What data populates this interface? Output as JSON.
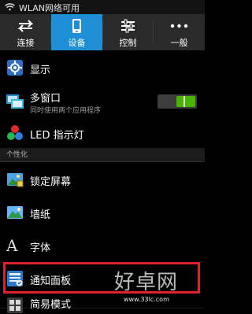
{
  "status_bar": {
    "wifi_icon": "wifi-icon",
    "text": "WLAN网络可用"
  },
  "tabs": [
    {
      "label": "连接",
      "icon": "swap-arrows-icon",
      "active": false
    },
    {
      "label": "设备",
      "icon": "phone-icon",
      "active": true
    },
    {
      "label": "控制",
      "icon": "sliders-icon",
      "active": false
    },
    {
      "label": "一般",
      "icon": "more-dots-icon",
      "active": false
    }
  ],
  "settings": {
    "display": {
      "label": "显示",
      "icon": "gear-screen-icon"
    },
    "multi_window": {
      "label": "多窗口",
      "subtitle": "同时使用两个应用程序",
      "icon": "multi-window-icon",
      "toggle_on": true
    },
    "led": {
      "label": "LED 指示灯",
      "icon": "led-icon"
    },
    "section_personalize": "个性化",
    "lock_screen": {
      "label": "锁定屏幕",
      "icon": "lock-screen-icon"
    },
    "wallpaper": {
      "label": "墙纸",
      "icon": "wallpaper-icon"
    },
    "font": {
      "label": "字体",
      "icon": "font-icon"
    },
    "notification_panel": {
      "label": "通知面板",
      "icon": "notification-panel-icon"
    },
    "easy_mode": {
      "label": "简易模式",
      "icon": "easy-mode-icon"
    }
  },
  "watermark": {
    "brand": "好卓网",
    "url": "www.33lc.com"
  },
  "colors": {
    "accent": "#1e8fd4",
    "toggle_on": "#46b400",
    "highlight": "#e0212a"
  }
}
